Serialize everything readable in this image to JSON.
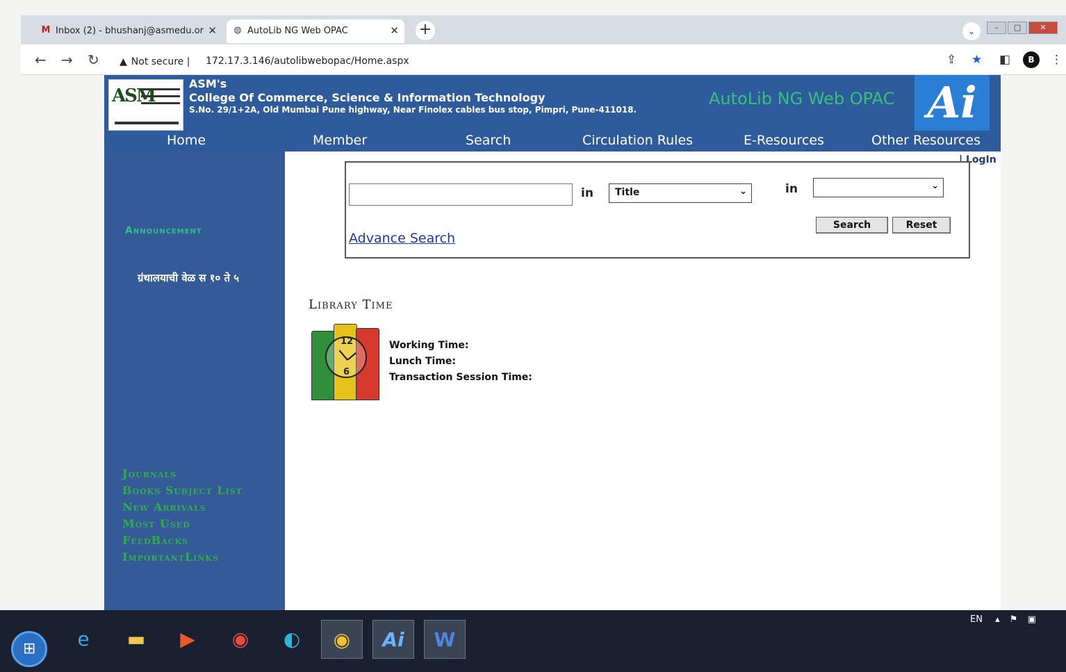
{
  "browser": {
    "tabs": [
      {
        "favicon": "gmail-icon",
        "title": "Inbox (2) - bhushanj@asmedu.or",
        "active": false
      },
      {
        "favicon": "globe-icon",
        "title": "AutoLib NG Web OPAC",
        "active": true
      }
    ],
    "security_label": "Not secure",
    "url": "172.17.3.146/autolibwebopac/Home.aspx"
  },
  "header": {
    "org_line1": "ASM's",
    "org_line2": "College Of Commerce, Science & Information Technology",
    "org_line3": "S.No. 29/1+2A, Old Mumbai Pune highway, Near Finolex cables bus stop, Pimpri, Pune-411018.",
    "brand": "AutoLib NG Web OPAC",
    "logo_text": "ASM"
  },
  "menu": {
    "items": [
      "Home",
      "Member",
      "Search",
      "Circulation Rules",
      "E-Resources",
      "Other Resources"
    ],
    "login": "| LogIn"
  },
  "sidebar": {
    "announcement_heading": "Announcement",
    "announcement_text": "ग्रंथालयाची वेळ स १० ते ५",
    "links": [
      "Journals",
      "Books Subject List",
      "New Arrivals",
      "Most Used",
      "FeedBacks",
      "ImportantLinks"
    ]
  },
  "search": {
    "query_value": "",
    "in_label_1": "in",
    "field_selected": "Title",
    "in_label_2": "in",
    "second_selected": "",
    "search_button": "Search",
    "reset_button": "Reset",
    "advance_link": "Advance Search"
  },
  "library_time": {
    "title": "Library Time",
    "clock_12": "12",
    "clock_6": "6",
    "working": "Working Time:",
    "lunch": "Lunch Time:",
    "transaction": "Transaction Session Time:"
  },
  "taskbar": {
    "tray_lang": "EN"
  },
  "colors": {
    "header_blue": "#2e5b9c",
    "sidebar_blue": "#355a98",
    "brand_green": "#38c07a",
    "link_blue": "#1c3aa8"
  }
}
